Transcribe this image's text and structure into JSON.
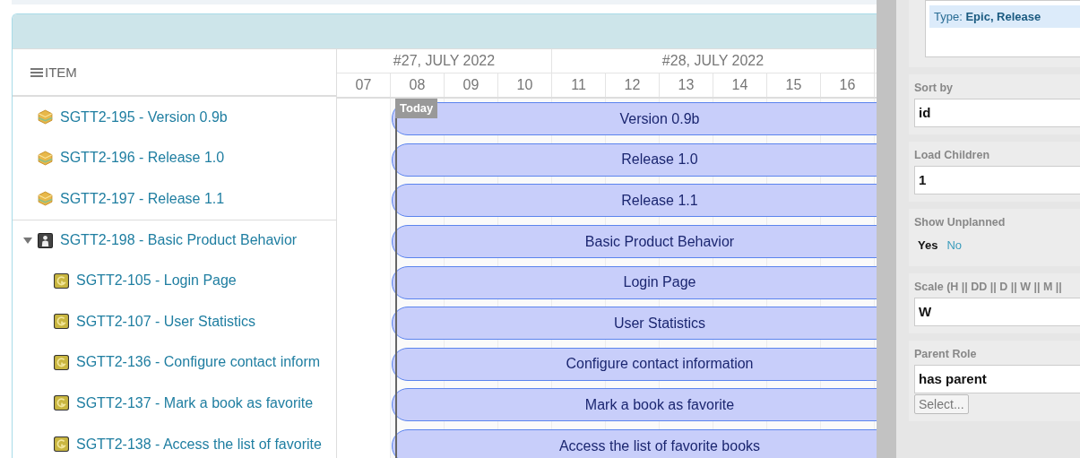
{
  "gantt": {
    "item_header": "ITEM",
    "weeks": [
      {
        "label": "#27, JULY 2022",
        "days": [
          "07",
          "08",
          "09",
          "10"
        ]
      },
      {
        "label": "#28, JULY 2022",
        "days": [
          "11",
          "12",
          "13",
          "14",
          "15",
          "16"
        ]
      }
    ],
    "today_label": "Today",
    "items": [
      {
        "kind": "release",
        "label": "SGTT2-195 - Version 0.9b",
        "bar": "Version 0.9b"
      },
      {
        "kind": "release",
        "label": "SGTT2-196 - Release 1.0",
        "bar": "Release 1.0"
      },
      {
        "kind": "release",
        "label": "SGTT2-197 - Release 1.1",
        "bar": "Release 1.1"
      },
      {
        "kind": "epic",
        "label": "SGTT2-198 - Basic Product Behavior",
        "bar": "Basic Product Behavior",
        "expanded": true,
        "children": [
          {
            "kind": "story",
            "label": "SGTT2-105 - Login Page",
            "bar": "Login Page"
          },
          {
            "kind": "story",
            "label": "SGTT2-107 - User Statistics",
            "bar": "User Statistics"
          },
          {
            "kind": "story",
            "label": "SGTT2-136 - Configure contact inform",
            "bar": "Configure contact information"
          },
          {
            "kind": "story",
            "label": "SGTT2-137 - Mark a book as favorite",
            "bar": "Mark a book as favorite"
          },
          {
            "kind": "story",
            "label": "SGTT2-138 - Access the list of favorite",
            "bar": "Access the list of favorite books"
          }
        ]
      }
    ]
  },
  "settings": {
    "filter_chip": "Type: **Epic, Release**",
    "sections": [
      {
        "kind": "field",
        "label": "Sort by",
        "value": "id"
      },
      {
        "kind": "field",
        "label": "Load Children",
        "value": "1"
      },
      {
        "kind": "toggle",
        "label": "Show Unplanned",
        "options": [
          {
            "label": "Yes",
            "selected": true
          },
          {
            "label": "No",
            "selected": false
          }
        ]
      },
      {
        "kind": "field",
        "label": "Scale (H || DD || D || W || M ||",
        "value": "W"
      },
      {
        "kind": "field",
        "label": "Parent Role",
        "value": "has parent",
        "button": "Select..."
      }
    ]
  }
}
